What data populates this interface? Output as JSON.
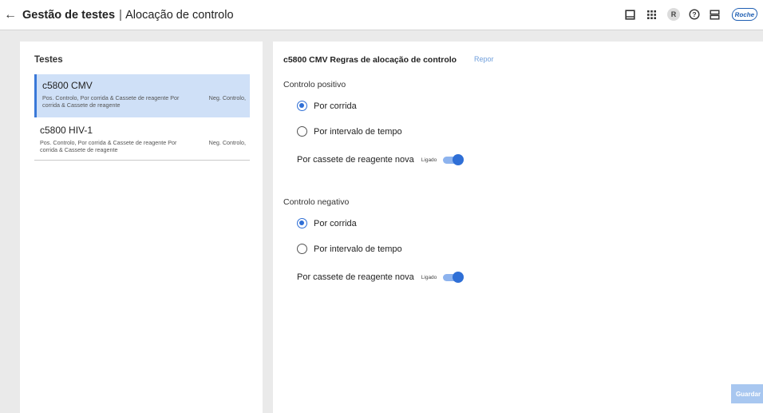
{
  "header": {
    "title_bold": "Gestão de testes",
    "separator": "|",
    "title_sub": "Alocação de controlo",
    "avatar_letter": "R",
    "brand": "Roche",
    "icons": [
      "back-arrow-icon",
      "tablet-icon",
      "apps-grid-icon",
      "help-icon",
      "server-icon"
    ]
  },
  "left": {
    "title": "Testes",
    "tests": [
      {
        "name": "c5800 CMV",
        "desc": "Pos. Controlo, Por corrida & Cassete de reagente Por corrida & Cassete de reagente",
        "neg": "Neg. Controlo,",
        "selected": true
      },
      {
        "name": "c5800 HIV-1",
        "desc": "Pos. Controlo, Por corrida & Cassete de reagente Por corrida & Cassete de reagente",
        "neg": "Neg. Controlo,",
        "selected": false
      }
    ]
  },
  "right": {
    "title": "c5800 CMV Regras de alocação de controlo",
    "reset": "Repor",
    "positive": {
      "heading": "Controlo positivo",
      "opt1": "Por corrida",
      "opt2": "Por intervalo de tempo",
      "selected": "Por corrida",
      "toggle_label": "Por cassete de reagente nova",
      "toggle_state": "Ligado",
      "toggle_on": true
    },
    "negative": {
      "heading": "Controlo negativo",
      "opt1": "Por corrida",
      "opt2": "Por intervalo de tempo",
      "selected": "Por corrida",
      "toggle_label": "Por cassete de reagente nova",
      "toggle_state": "Ligado",
      "toggle_on": true
    },
    "save": "Guardar"
  },
  "colors": {
    "accent": "#2f6fd6",
    "selected_bg": "#cfe0f7",
    "save_disabled": "#a8c7f0",
    "brand": "#1f5fb3"
  }
}
